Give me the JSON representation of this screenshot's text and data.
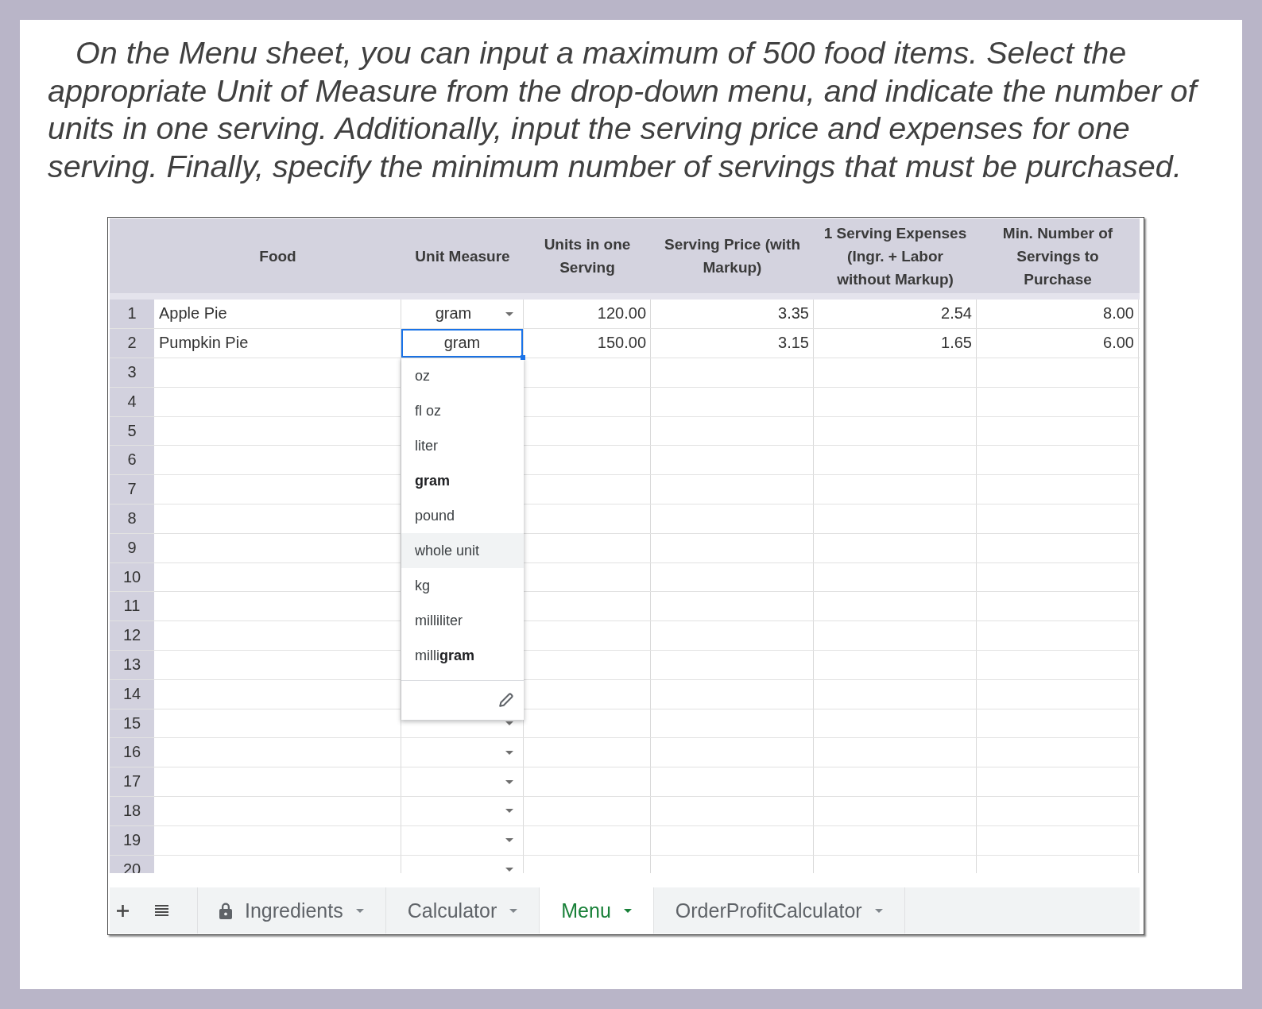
{
  "instructions": "On the Menu sheet, you can input a maximum of 500 food items. Select the appropriate Unit of Measure from the drop-down menu, and indicate the number of units in one serving. Additionally, input the serving price and expenses for one serving. Finally, specify the minimum number of servings that must be purchased.",
  "sheet": {
    "columns": [
      {
        "label": "Food",
        "kind": "text"
      },
      {
        "label": "Unit Measure",
        "kind": "choice"
      },
      {
        "label": "Units in one Serving",
        "kind": "number"
      },
      {
        "label": "Serving Price (with Markup)",
        "kind": "number"
      },
      {
        "label": "1 Serving Expenses (Ingr. + Labor without Markup)",
        "kind": "number"
      },
      {
        "label": "Min. Number of Servings to Purchase",
        "kind": "number"
      }
    ],
    "rows": [
      {
        "number": "1",
        "cells": [
          "Apple Pie",
          "gram",
          "120.00",
          "3.35",
          "2.54",
          "8.00"
        ],
        "selected": false
      },
      {
        "number": "2",
        "cells": [
          "Pumpkin Pie",
          "gram",
          "150.00",
          "3.15",
          "1.65",
          "6.00"
        ],
        "selected": true
      },
      {
        "number": "3",
        "selected": false
      },
      {
        "number": "4",
        "selected": false
      },
      {
        "number": "5",
        "selected": false
      },
      {
        "number": "6",
        "selected": false
      },
      {
        "number": "7",
        "selected": false
      },
      {
        "number": "8",
        "selected": false
      },
      {
        "number": "9",
        "selected": false
      },
      {
        "number": "10",
        "selected": false
      },
      {
        "number": "11",
        "selected": false
      },
      {
        "number": "12",
        "selected": false
      },
      {
        "number": "13",
        "selected": false
      },
      {
        "number": "14",
        "selected": false
      },
      {
        "number": "15",
        "selected": false
      },
      {
        "number": "16",
        "selected": false
      },
      {
        "number": "17",
        "selected": false
      },
      {
        "number": "18",
        "selected": false
      },
      {
        "number": "19",
        "selected": false
      },
      {
        "number": "20",
        "selected": false
      }
    ],
    "dropdown_menu": {
      "options": [
        {
          "label": "oz",
          "selected": false,
          "hovered": false
        },
        {
          "label": "fl oz",
          "selected": false,
          "hovered": false
        },
        {
          "label": "liter",
          "selected": false,
          "hovered": false
        },
        {
          "label": "gram",
          "selected": true,
          "hovered": false
        },
        {
          "label": "pound",
          "selected": false,
          "hovered": false
        },
        {
          "label": "whole unit",
          "selected": false,
          "hovered": true
        },
        {
          "label": "kg",
          "selected": false,
          "hovered": false
        },
        {
          "label": "milliliter",
          "selected": false,
          "hovered": false
        },
        {
          "label": "milli**gram**",
          "selected": false,
          "hovered": false
        }
      ]
    }
  },
  "tabs": [
    {
      "label": "Ingredients",
      "locked": true,
      "selected": false
    },
    {
      "label": "Calculator",
      "locked": false,
      "selected": false
    },
    {
      "label": "Menu",
      "locked": false,
      "selected": true
    },
    {
      "label": "OrderProfitCalculator",
      "locked": false,
      "selected": false
    }
  ]
}
